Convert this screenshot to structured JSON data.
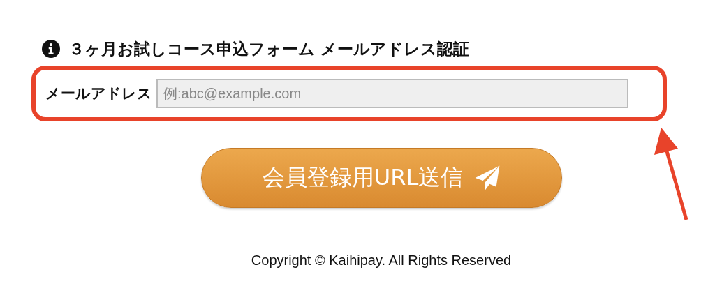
{
  "form": {
    "title": "３ヶ月お試しコース申込フォーム メールアドレス認証",
    "email_label": "メールアドレス",
    "email_placeholder": "例:abc@example.com",
    "submit_label": "会員登録用URL送信"
  },
  "footer": {
    "copyright": "Copyright © Kaihipay. All Rights Reserved"
  }
}
